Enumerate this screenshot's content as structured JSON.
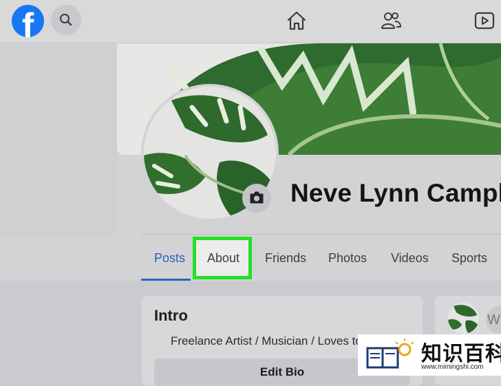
{
  "nav": {
    "logo_letter": "f",
    "icons": [
      "facebook-logo-icon",
      "search-icon",
      "home-icon",
      "friends-icon",
      "watch-icon"
    ]
  },
  "profile": {
    "name": "Neve Lynn Campb"
  },
  "tabs": [
    {
      "label": "Posts",
      "active": true
    },
    {
      "label": "About",
      "active": false,
      "highlighted": true
    },
    {
      "label": "Friends",
      "active": false
    },
    {
      "label": "Photos",
      "active": false
    },
    {
      "label": "Videos",
      "active": false
    },
    {
      "label": "Sports",
      "active": false
    }
  ],
  "intro": {
    "title": "Intro",
    "bio": "Freelance Artist / Musician / Loves to",
    "edit_bio_label": "Edit Bio"
  },
  "composer": {
    "placeholder": "W"
  },
  "watermark": {
    "text_cn": "知识百科",
    "url": "www.mimingshi.com"
  },
  "colors": {
    "brand": "#1877f2",
    "highlight_box": "#22e022",
    "active_tab": "#2a5fb3"
  }
}
